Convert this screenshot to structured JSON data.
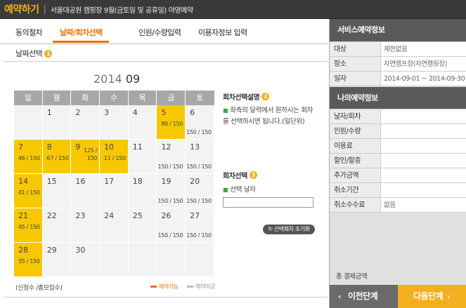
{
  "header": {
    "app_title": "예약하기",
    "subtitle": "서울대공원 캠핑장 9월(금토일 및 공휴일) 야영예약"
  },
  "steps": [
    {
      "label": "동의절차"
    },
    {
      "label": "날짜/회차선택"
    },
    {
      "label": "인원/수량입력"
    },
    {
      "label": "이용자정보 입력"
    }
  ],
  "date_section": {
    "title": "날짜선택",
    "badge": "1"
  },
  "calendar": {
    "year": "2014",
    "month": "09",
    "weekdays": [
      "일",
      "월",
      "화",
      "수",
      "목",
      "금",
      "토"
    ],
    "days": [
      {
        "day": "",
        "info": "",
        "available": false
      },
      {
        "day": "1",
        "info": "",
        "available": false
      },
      {
        "day": "2",
        "info": "",
        "available": false
      },
      {
        "day": "3",
        "info": "",
        "available": false
      },
      {
        "day": "4",
        "info": "",
        "available": false
      },
      {
        "day": "5",
        "info": "80 / 150",
        "available": true
      },
      {
        "day": "6",
        "info": "150 / 150",
        "available": false
      },
      {
        "day": "7",
        "info": "46 / 150",
        "available": true
      },
      {
        "day": "8",
        "info": "67 / 150",
        "available": true
      },
      {
        "day": "9",
        "info": "125 / 150",
        "available": true
      },
      {
        "day": "10",
        "info": "11 / 150",
        "available": true
      },
      {
        "day": "11",
        "info": "",
        "available": false
      },
      {
        "day": "12",
        "info": "150 / 150",
        "available": false
      },
      {
        "day": "13",
        "info": "150 / 150",
        "available": false
      },
      {
        "day": "14",
        "info": "41 / 150",
        "available": true
      },
      {
        "day": "15",
        "info": "",
        "available": false
      },
      {
        "day": "16",
        "info": "",
        "available": false
      },
      {
        "day": "17",
        "info": "",
        "available": false
      },
      {
        "day": "18",
        "info": "",
        "available": false
      },
      {
        "day": "19",
        "info": "150 / 150",
        "available": false
      },
      {
        "day": "20",
        "info": "150 / 150",
        "available": false
      },
      {
        "day": "21",
        "info": "45 / 150",
        "available": true
      },
      {
        "day": "22",
        "info": "",
        "available": false
      },
      {
        "day": "23",
        "info": "",
        "available": false
      },
      {
        "day": "24",
        "info": "",
        "available": false
      },
      {
        "day": "25",
        "info": "",
        "available": false
      },
      {
        "day": "26",
        "info": "150 / 150",
        "available": false
      },
      {
        "day": "27",
        "info": "150 / 150",
        "available": false
      },
      {
        "day": "28",
        "info": "35 / 150",
        "available": true
      },
      {
        "day": "29",
        "info": "",
        "available": false
      },
      {
        "day": "30",
        "info": "",
        "available": false
      },
      {
        "day": "",
        "info": "",
        "available": false
      },
      {
        "day": "",
        "info": "",
        "available": false
      },
      {
        "day": "",
        "info": "",
        "available": false
      },
      {
        "day": "",
        "info": "",
        "available": false
      }
    ]
  },
  "legend": {
    "count_label": "(신청수 /총모집수)",
    "available": "예약가능",
    "closed": "예약마감"
  },
  "session_desc": {
    "title": "회차선택설명",
    "badge": "2",
    "text": "좌측의 달력에서 원하시는 회차를 선택하시면 됩니다.(일단위)"
  },
  "session_select": {
    "title": "회차선택",
    "badge": "3",
    "label": "선택 날자",
    "value": ""
  },
  "reset_button": {
    "label": "선택회차 초기화"
  },
  "service_info": {
    "title": "서비스예약정보",
    "rows": [
      {
        "key": "대상",
        "value": "제한없음"
      },
      {
        "key": "장소",
        "value": "자연캠프장(자연캠핑장)"
      },
      {
        "key": "일자",
        "value": "2014-09-01 ~ 2014-09-30"
      }
    ]
  },
  "my_info": {
    "title": "나의예약정보",
    "rows": [
      {
        "key": "날자/회차",
        "value": ""
      },
      {
        "key": "인원/수량",
        "value": ""
      },
      {
        "key": "이용료",
        "value": ""
      },
      {
        "key": "할인/할증",
        "value": ""
      },
      {
        "key": "추가금액",
        "value": ""
      },
      {
        "key": "취소기간",
        "value": ""
      },
      {
        "key": "취소수수료",
        "value": "없음"
      }
    ]
  },
  "total_label": "총 결제금액",
  "nav": {
    "prev": "이전단계",
    "next": "다음단계"
  },
  "colors": {
    "accent": "#e8730a",
    "available": "#f7c800",
    "badge": "#f2b01e",
    "panel_header": "#5a5a5a"
  }
}
